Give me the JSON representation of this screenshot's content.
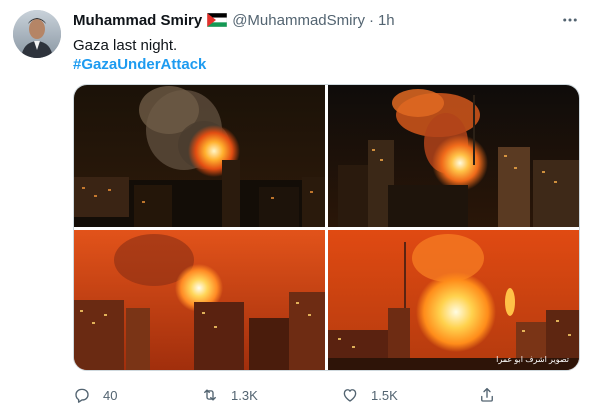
{
  "author": {
    "display_name": "Muhammad Smiry",
    "handle": "@MuhammadSmiry",
    "separator": "·",
    "time": "1h",
    "flag_icon": "palestine-flag-icon",
    "avatar_icon": "profile-avatar"
  },
  "tweet": {
    "text": "Gaza last night.",
    "hashtag": "#GazaUnderAttack"
  },
  "media": {
    "photos": [
      {
        "icon": "explosion-photo-1"
      },
      {
        "icon": "explosion-photo-2"
      },
      {
        "icon": "explosion-photo-3"
      },
      {
        "icon": "explosion-photo-4",
        "watermark": "تصوير اشرف ابو عمرا"
      }
    ]
  },
  "actions": {
    "reply_count": "40",
    "retweet_count": "1.3K",
    "like_count": "1.5K",
    "icons": [
      "reply-icon",
      "retweet-icon",
      "like-icon",
      "share-icon"
    ]
  },
  "colors": {
    "link_blue": "#1d9bf0",
    "muted": "#536471",
    "text": "#0f1419",
    "border": "#cfd9de"
  }
}
